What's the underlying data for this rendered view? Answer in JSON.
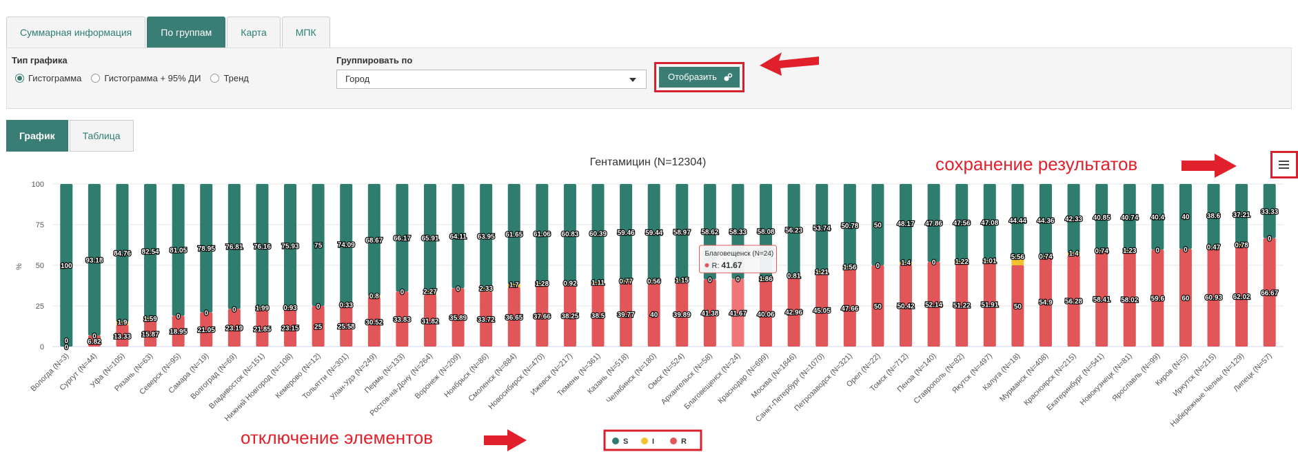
{
  "tabs": [
    {
      "label": "Суммарная информация"
    },
    {
      "label": "По группам"
    },
    {
      "label": "Карта"
    },
    {
      "label": "МПК"
    }
  ],
  "controls": {
    "chart_type_label": "Тип графика",
    "options": [
      "Гистограмма",
      "Гистограмма + 95% ДИ",
      "Тренд"
    ],
    "selected_option": "Гистограмма",
    "group_by_label": "Группировать по",
    "group_by_value": "Город",
    "submit_label": "Отобразить"
  },
  "view_tabs": [
    {
      "label": "График"
    },
    {
      "label": "Таблица"
    }
  ],
  "annotations": {
    "save": "сохранение результатов",
    "toggle": "отключение элементов"
  },
  "tooltip": {
    "title": "Благовещенск (N=24)",
    "series": "R",
    "value": "41.67"
  },
  "colors": {
    "S": "#2f7d6e",
    "I": "#f2c12e",
    "R": "#e15759",
    "accent": "#3a7d74",
    "annotation": "#e0202a"
  },
  "chart_data": {
    "type": "bar",
    "stacked": true,
    "title": "Гентамицин (N=12304)",
    "xlabel": "",
    "ylabel": "%",
    "ylim": [
      0,
      100
    ],
    "yticks": [
      0,
      25,
      50,
      75,
      100
    ],
    "legend_position": "bottom-center",
    "categories": [
      "Вологда (N=3)",
      "Сургут (N=44)",
      "Уфа (N=105)",
      "Рязань (N=63)",
      "Северск (N=95)",
      "Самара (N=19)",
      "Волгоград (N=69)",
      "Владивосток (N=151)",
      "Нижний Новгород (N=108)",
      "Кемерово (N=12)",
      "Тольятти (N=301)",
      "Улан-Удэ (N=249)",
      "Пермь (N=133)",
      "Ростов-на-Дону (N=264)",
      "Воронеж (N=209)",
      "Ноябрьск (N=86)",
      "Смоленск (N=884)",
      "Новосибирск (N=470)",
      "Ижевск (N=217)",
      "Тюмень (N=361)",
      "Казань (N=518)",
      "Челябинск (N=180)",
      "Омск (N=524)",
      "Архангельск (N=58)",
      "Благовещенск (N=24)",
      "Краснодар (N=699)",
      "Москва (N=1846)",
      "Санкт-Петербург (N=1070)",
      "Петрозаводск (N=321)",
      "Орел (N=22)",
      "Томск (N=712)",
      "Пенза (N=140)",
      "Ставрополь (N=82)",
      "Якутск (N=497)",
      "Калуга (N=18)",
      "Мурманск (N=408)",
      "Красноярск (N=215)",
      "Екатеринбург (N=541)",
      "Новокузнецк (N=81)",
      "Ярославль (N=99)",
      "Киров (N=5)",
      "Иркутск (N=215)",
      "Набережные Челны (N=129)",
      "Липецк (N=57)"
    ],
    "series": [
      {
        "name": "S",
        "values": [
          100,
          93.18,
          84.76,
          82.54,
          81.05,
          78.95,
          76.81,
          76.16,
          75.93,
          75,
          74.09,
          68.67,
          66.17,
          65.91,
          64.11,
          63.95,
          61.65,
          61.06,
          60.83,
          60.39,
          59.46,
          59.44,
          58.97,
          58.62,
          58.33,
          58.08,
          56.23,
          53.74,
          50.78,
          50,
          48.17,
          47.86,
          47.56,
          47.08,
          44.44,
          44.36,
          42.33,
          40.85,
          40.74,
          40.4,
          40,
          38.6,
          37.21,
          33.33
        ]
      },
      {
        "name": "I",
        "values": [
          0,
          0,
          1.9,
          1.59,
          0,
          0,
          0,
          1.99,
          0.93,
          0,
          0.33,
          0.8,
          0,
          2.27,
          0,
          2.33,
          1.7,
          1.28,
          0.92,
          1.11,
          0.77,
          0.56,
          1.15,
          0,
          0,
          1.86,
          0.81,
          1.21,
          1.56,
          0,
          1.4,
          0,
          1.22,
          1.01,
          5.56,
          0.74,
          1.4,
          0.74,
          1.23,
          0,
          0,
          0.47,
          0.78,
          0
        ]
      },
      {
        "name": "R",
        "values": [
          0,
          6.82,
          13.33,
          15.87,
          18.95,
          21.05,
          23.19,
          21.85,
          23.15,
          25,
          25.58,
          30.52,
          33.83,
          31.82,
          35.89,
          33.72,
          36.65,
          37.66,
          38.25,
          38.5,
          39.77,
          40,
          39.89,
          41.38,
          41.67,
          40.06,
          42.96,
          45.05,
          47.66,
          50,
          50.42,
          52.14,
          51.22,
          51.91,
          50,
          54.9,
          56.28,
          58.41,
          58.02,
          59.6,
          60,
          60.93,
          62.02,
          66.67
        ]
      }
    ]
  }
}
